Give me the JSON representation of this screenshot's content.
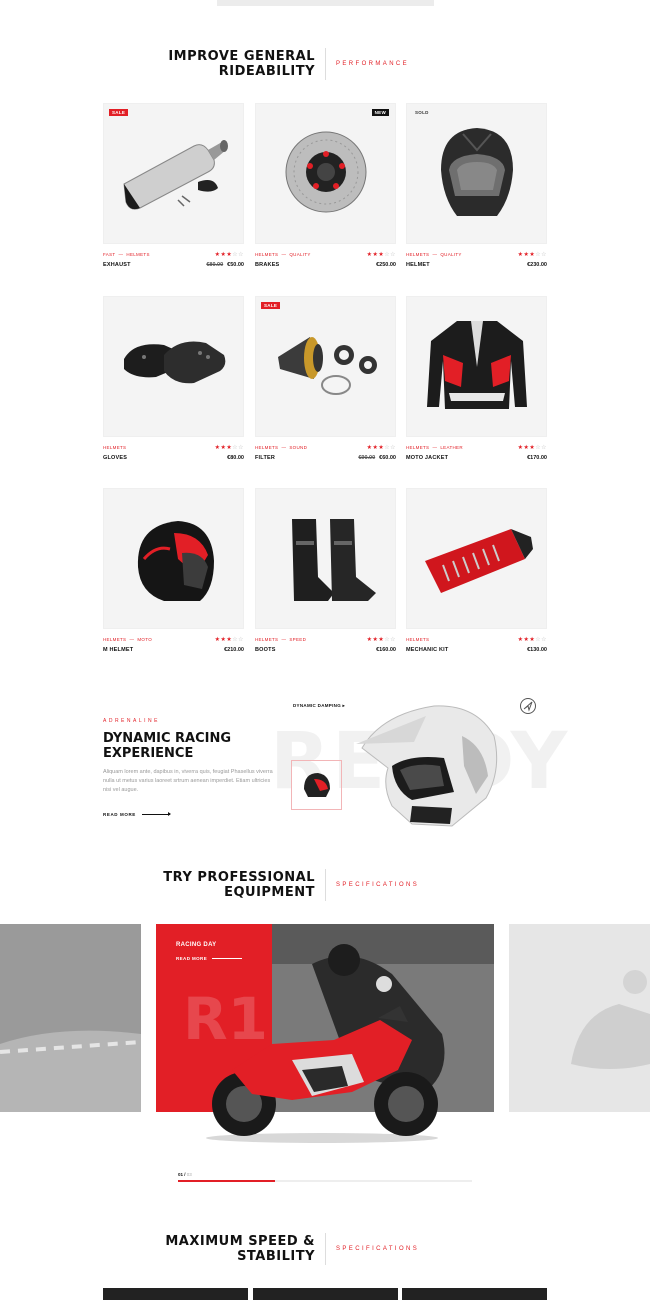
{
  "section1": {
    "title_line1": "IMPROVE GENERAL",
    "title_line2": "RIDEABILITY",
    "subtitle": "PERFORMANCE"
  },
  "products": [
    {
      "name": "EXHAUST",
      "cat1": "FAST",
      "cat2": "HELMETS",
      "badge": "SALE",
      "old_price": "€80.00",
      "price": "€50.00",
      "rating": 3,
      "icon": "exhaust-icon"
    },
    {
      "name": "BRAKES",
      "cat1": "HELMETS",
      "cat2": "QUALITY",
      "badge": "NEW",
      "old_price": "",
      "price": "€250.00",
      "rating": 3,
      "icon": "brake-disc-icon"
    },
    {
      "name": "HELMET",
      "cat1": "HELMETS",
      "cat2": "QUALITY",
      "badge": "SOLD",
      "old_price": "",
      "price": "€230.00",
      "rating": 3,
      "icon": "helmet-icon"
    },
    {
      "name": "GLOVES",
      "cat1": "HELMETS",
      "cat2": "",
      "badge": "",
      "old_price": "",
      "price": "€80.00",
      "rating": 3,
      "icon": "gloves-icon"
    },
    {
      "name": "FILTER",
      "cat1": "HELMETS",
      "cat2": "SOUND",
      "badge": "SALE",
      "old_price": "€90.00",
      "price": "€60.00",
      "rating": 3,
      "icon": "air-filter-icon"
    },
    {
      "name": "MOTO JACKET",
      "cat1": "HELMETS",
      "cat2": "LEATHER",
      "badge": "",
      "old_price": "",
      "price": "€170.00",
      "rating": 3,
      "icon": "jacket-icon"
    },
    {
      "name": "M HELMET",
      "cat1": "HELMETS",
      "cat2": "MOTO",
      "badge": "",
      "old_price": "",
      "price": "€210.00",
      "rating": 3,
      "icon": "helmet-icon"
    },
    {
      "name": "BOOTS",
      "cat1": "HELMETS",
      "cat2": "SPEED",
      "badge": "",
      "old_price": "",
      "price": "€160.00",
      "rating": 3,
      "icon": "boots-icon"
    },
    {
      "name": "MECHANIC KIT",
      "cat1": "HELMETS",
      "cat2": "",
      "badge": "",
      "old_price": "",
      "price": "€130.00",
      "rating": 3,
      "icon": "tool-kit-icon"
    }
  ],
  "hero": {
    "label": "ADRENALINE",
    "title_line1": "DYNAMIC RACING",
    "title_line2": "EXPERIENCE",
    "text": "Aliquam lorem ante, dapibus in, viverra quis, feugiat Phasellus viverra nulla ut metus varius laoreet srtrum aenean imperdiet. Etiam ultricies nisi vel augue.",
    "read_more": "READ MORE",
    "hotspot": "DYNAMIC DAMPING",
    "bg_word": "READY"
  },
  "section2": {
    "title_line1": "TRY PROFESSIONAL",
    "title_line2": "EQUIPMENT",
    "subtitle": "SPECIFICATIONS"
  },
  "slider": {
    "slide_title": "RACING DAY",
    "slide_link": "READ MORE",
    "bg_word": "R1",
    "current": "01",
    "total": "03",
    "progress": 0.33
  },
  "section3": {
    "title_line1": "MAXIMUM SPEED &",
    "title_line2": "STABILITY",
    "subtitle": "SPECIFICATIONS"
  },
  "colors": {
    "accent": "#e21f26",
    "dark": "#111111",
    "tile": "#f4f4f4"
  }
}
